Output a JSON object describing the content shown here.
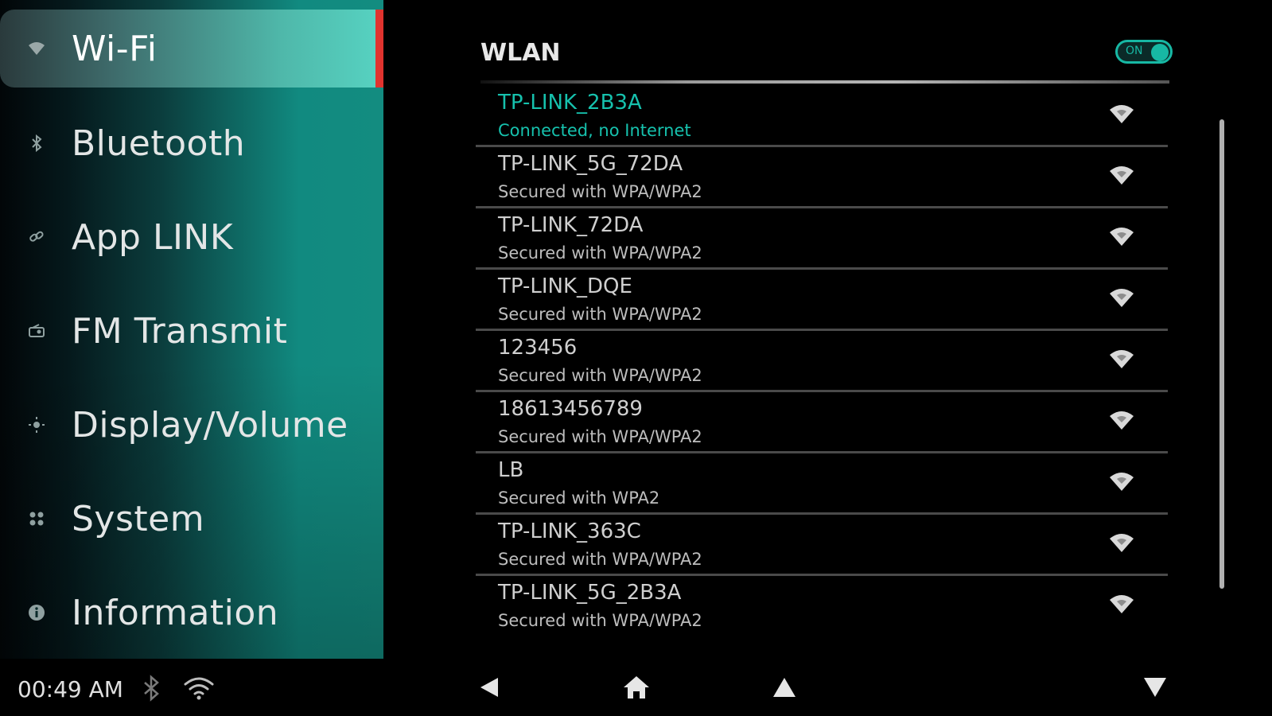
{
  "sidebar": {
    "items": [
      {
        "label": "Wi-Fi",
        "icon": "wifi-icon",
        "active": true
      },
      {
        "label": "Bluetooth",
        "icon": "bluetooth-icon"
      },
      {
        "label": "App LINK",
        "icon": "link-icon"
      },
      {
        "label": "FM Transmit",
        "icon": "radio-icon"
      },
      {
        "label": "Display/Volume",
        "icon": "brightness-icon"
      },
      {
        "label": "System",
        "icon": "system-icon"
      },
      {
        "label": "Information",
        "icon": "info-icon"
      }
    ]
  },
  "wlan": {
    "title": "WLAN",
    "toggle_label": "ON",
    "enabled": true,
    "accent": "#16c1ad",
    "networks": [
      {
        "ssid": "TP-LINK_2B3A",
        "status": "Connected, no Internet",
        "connected": true
      },
      {
        "ssid": "TP-LINK_5G_72DA",
        "status": "Secured with WPA/WPA2"
      },
      {
        "ssid": "TP-LINK_72DA",
        "status": "Secured with WPA/WPA2"
      },
      {
        "ssid": "TP-LINK_DQE",
        "status": "Secured with WPA/WPA2"
      },
      {
        "ssid": "123456",
        "status": "Secured with WPA/WPA2"
      },
      {
        "ssid": "18613456789",
        "status": "Secured with WPA/WPA2"
      },
      {
        "ssid": "LB",
        "status": "Secured with WPA2"
      },
      {
        "ssid": "TP-LINK_363C",
        "status": "Secured with WPA/WPA2"
      },
      {
        "ssid": "TP-LINK_5G_2B3A",
        "status": "Secured with WPA/WPA2"
      }
    ]
  },
  "statusbar": {
    "time": "00:49 AM",
    "icons": [
      "bluetooth-icon",
      "wifi-icon"
    ]
  },
  "navbar": {
    "buttons": [
      "back-icon",
      "home-icon",
      "up-icon",
      "down-icon"
    ]
  },
  "colors": {
    "active_indicator": "#e0332e",
    "accent": "#16c1ad"
  }
}
